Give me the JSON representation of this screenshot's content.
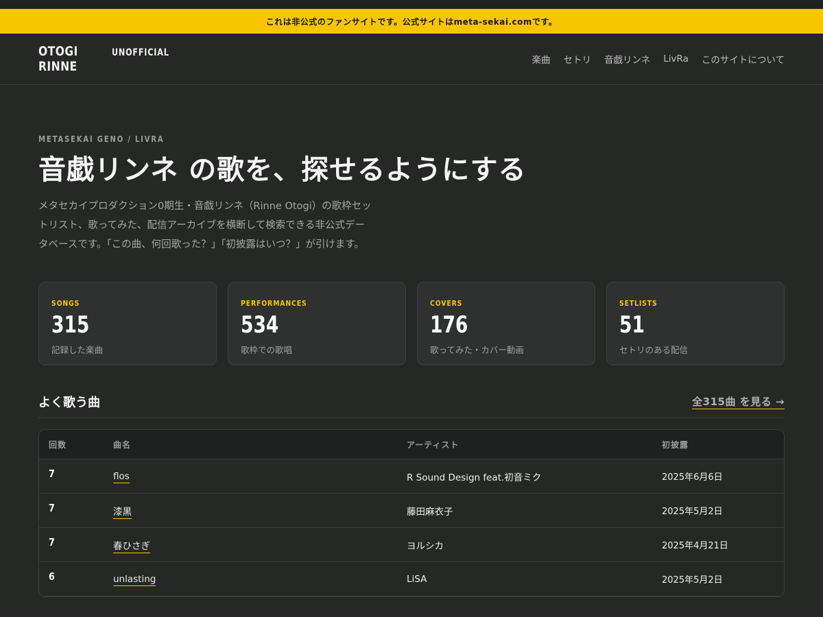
{
  "notice": "これは非公式のファンサイトです。公式サイトはmeta-sekai.comです。",
  "header": {
    "logo_main": "OTOGI RINNE",
    "logo_sub": "UNOFFICIAL",
    "nav": [
      "楽曲",
      "セトリ",
      "音戯リンネ",
      "LivRa",
      "このサイトについて"
    ]
  },
  "hero": {
    "eyebrow": "METASEKAI GENO / LIVRA",
    "title": "音戯リンネ の歌を、探せるようにする",
    "description": "メタセカイプロダクション0期生・音戯リンネ（Rinne Otogi）の歌枠セットリスト、歌ってみた、配信アーカイブを横断して検索できる非公式データベースです。「この曲、何回歌った？」「初披露はいつ？」が引けます。"
  },
  "stats": [
    {
      "label": "SONGS",
      "value": "315",
      "caption": "記録した楽曲"
    },
    {
      "label": "PERFORMANCES",
      "value": "534",
      "caption": "歌枠での歌唱"
    },
    {
      "label": "COVERS",
      "value": "176",
      "caption": "歌ってみた・カバー動画"
    },
    {
      "label": "SETLISTS",
      "value": "51",
      "caption": "セトリのある配信"
    }
  ],
  "popular": {
    "title": "よく歌う曲",
    "link": "全315曲 を見る →",
    "columns": [
      "回数",
      "曲名",
      "アーティスト",
      "初披露"
    ],
    "rows": [
      {
        "count": "7",
        "song": "flos",
        "artist": "R Sound Design feat.初音ミク",
        "date": "2025年6月6日"
      },
      {
        "count": "7",
        "song": "漆黒",
        "artist": "藤田麻衣子",
        "date": "2025年5月2日"
      },
      {
        "count": "7",
        "song": "春ひさぎ",
        "artist": "ヨルシカ",
        "date": "2025年4月21日"
      },
      {
        "count": "6",
        "song": "unlasting",
        "artist": "LiSA",
        "date": "2025年5月2日"
      }
    ]
  },
  "colors": {
    "accent": "#f7c600",
    "background": "#262826",
    "card": "#2e3130"
  }
}
